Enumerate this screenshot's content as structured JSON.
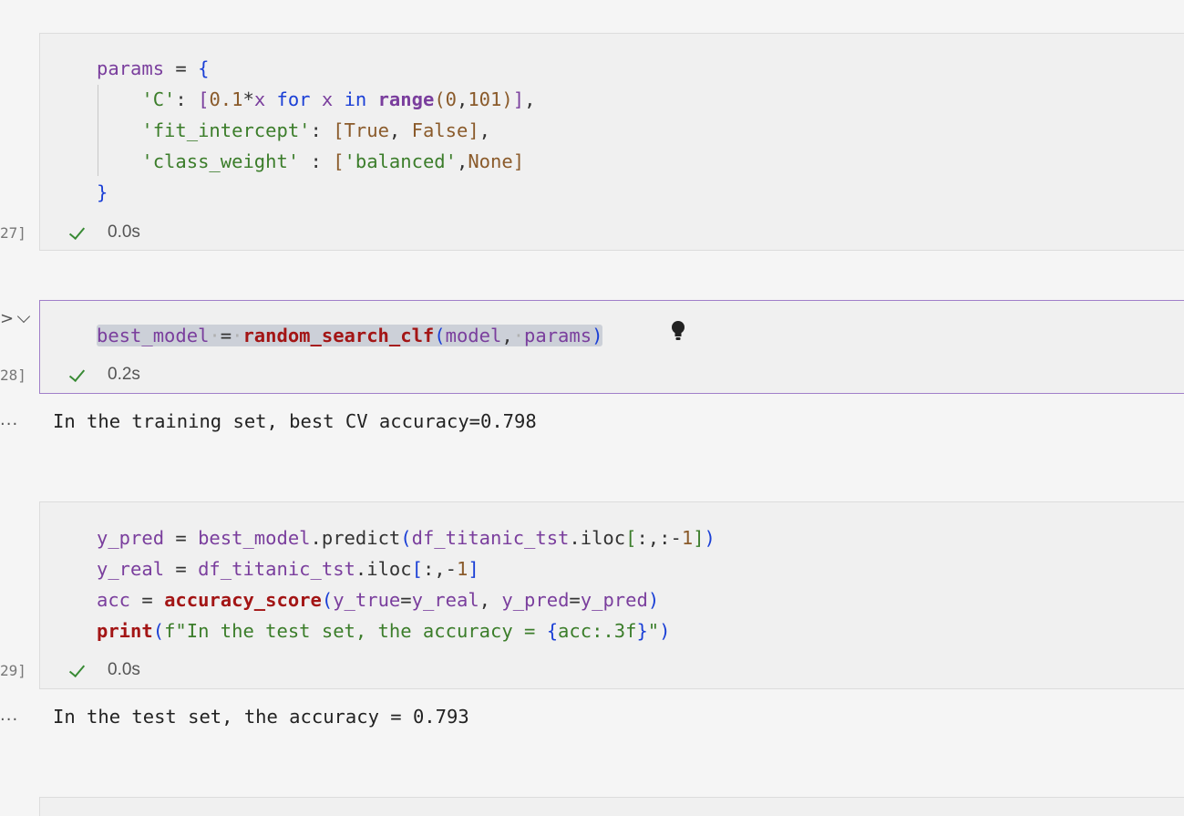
{
  "cells": [
    {
      "execution_count": "27]",
      "status_time": "0.0s",
      "code_lines": [
        "params = {",
        "    'C': [0.1*x for x in range(0,101)],",
        "    'fit_intercept': [True, False],",
        "    'class_weight' : ['balanced',None]",
        "}"
      ]
    },
    {
      "execution_count": "28]",
      "status_time": "0.2s",
      "code_lines": [
        "best_model = random_search_clf(model, params)"
      ],
      "output": "In the training set, best CV accuracy=0.798"
    },
    {
      "execution_count": "29]",
      "status_time": "0.0s",
      "code_lines": [
        "y_pred = best_model.predict(df_titanic_tst.iloc[:,:-1])",
        "y_real = df_titanic_tst.iloc[:,-1]",
        "acc = accuracy_score(y_true=y_real, y_pred=y_pred)",
        "print(f\"In the test set, the accuracy = {acc:.3f}\")"
      ],
      "output": "In the test set, the accuracy = 0.793"
    }
  ],
  "icons": {
    "run": "run-caret-icon",
    "collapse": "chevron-down-icon",
    "success": "check-icon",
    "output_menu": "more-dots-icon",
    "hint": "lightbulb-icon"
  },
  "colors": {
    "selected_border": "#a07fc9",
    "success": "#388a34"
  },
  "output_dots": "..."
}
